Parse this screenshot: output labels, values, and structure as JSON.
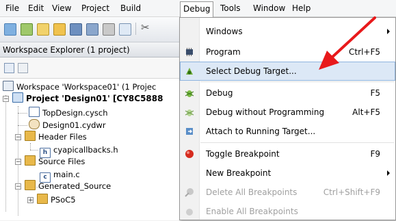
{
  "menubar": {
    "items": [
      "File",
      "Edit",
      "View",
      "Project",
      "Build",
      "Debug",
      "Tools",
      "Window",
      "Help"
    ]
  },
  "panel": {
    "title": "Workspace Explorer (1 project)"
  },
  "tree": {
    "workspace": "Workspace 'Workspace01' (1 Projec",
    "project": "Project  'Design01' [CY8C5888",
    "items": {
      "topdesign": "TopDesign.cysch",
      "design01": "Design01.cydwr",
      "header_files": "Header Files",
      "cyapicallbacks": "cyapicallbacks.h",
      "source_files": "Source Files",
      "main_c": "main.c",
      "generated_source": "Generated_Source",
      "psoc5": "PSoC5"
    }
  },
  "debug_menu": {
    "items": [
      {
        "label": "Windows",
        "shortcut": "",
        "submenu": true,
        "disabled": false
      },
      {
        "label": "Program",
        "shortcut": "Ctrl+F5",
        "submenu": false,
        "disabled": false
      },
      {
        "label": "Select Debug Target...",
        "shortcut": "",
        "submenu": false,
        "disabled": false,
        "highlighted": true
      },
      {
        "label": "Debug",
        "shortcut": "F5",
        "submenu": false,
        "disabled": false
      },
      {
        "label": "Debug without Programming",
        "shortcut": "Alt+F5",
        "submenu": false,
        "disabled": false
      },
      {
        "label": "Attach to Running Target...",
        "shortcut": "",
        "submenu": false,
        "disabled": false
      },
      {
        "label": "Toggle Breakpoint",
        "shortcut": "F9",
        "submenu": false,
        "disabled": false
      },
      {
        "label": "New Breakpoint",
        "shortcut": "",
        "submenu": true,
        "disabled": false
      },
      {
        "label": "Delete All Breakpoints",
        "shortcut": "Ctrl+Shift+F9",
        "submenu": false,
        "disabled": true
      },
      {
        "label": "Enable All Breakpoints",
        "shortcut": "",
        "submenu": false,
        "disabled": true
      }
    ]
  },
  "colors": {
    "highlight": "#dce8f6",
    "highlight_border": "#8eb4de",
    "annotation_arrow": "#e8191b",
    "folder": "#e8b84a"
  }
}
